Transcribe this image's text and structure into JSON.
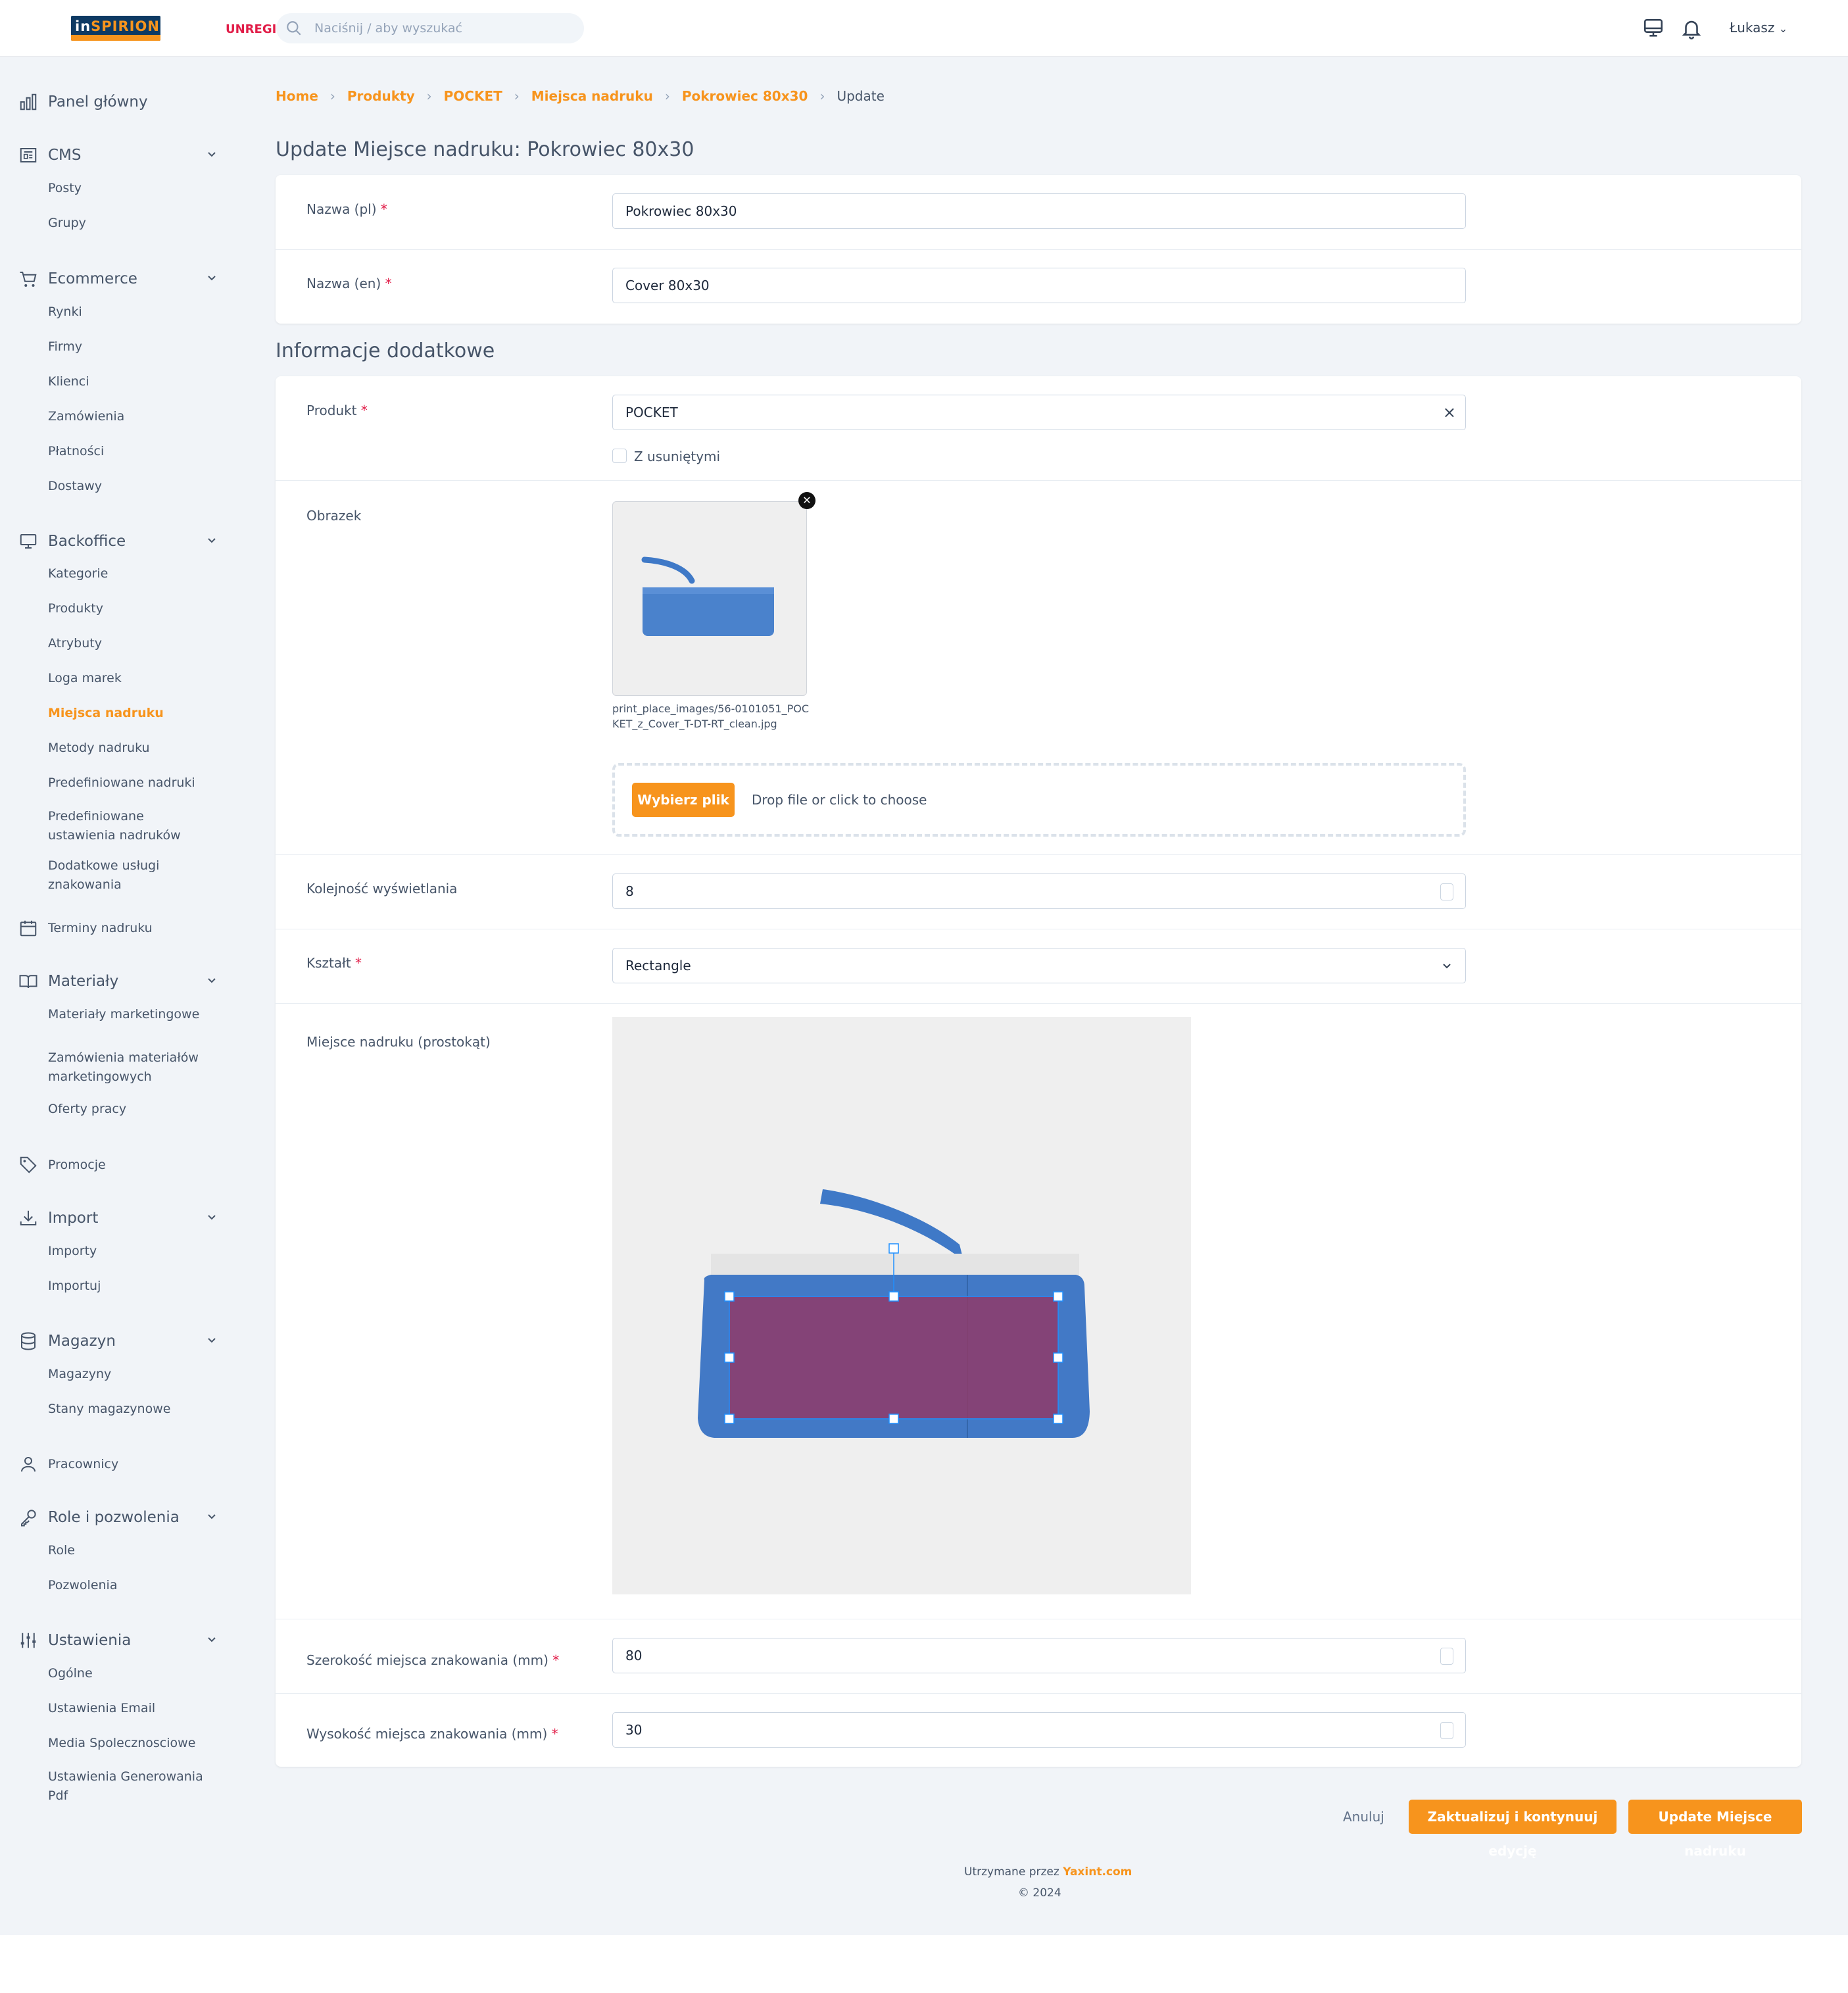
{
  "header": {
    "logo_text_a": "in",
    "logo_text_b": "SPIRION",
    "unregistered": "UNREGIS",
    "search_placeholder": "Naciśnij / aby wyszukać",
    "user_name": "Łukasz"
  },
  "sidebar": {
    "panel": "Panel główny",
    "cms": {
      "label": "CMS",
      "items": [
        "Posty",
        "Grupy"
      ]
    },
    "ecommerce": {
      "label": "Ecommerce",
      "items": [
        "Rynki",
        "Firmy",
        "Klienci",
        "Zamówienia",
        "Płatności",
        "Dostawy"
      ]
    },
    "backoffice": {
      "label": "Backoffice",
      "items": [
        "Kategorie",
        "Produkty",
        "Atrybuty",
        "Loga marek",
        "Miejsca nadruku",
        "Metody nadruku",
        "Predefiniowane nadruki",
        "Predefiniowane ustawienia nadruków",
        "Dodatkowe usługi znakowania"
      ]
    },
    "terminy": "Terminy nadruku",
    "materialy": {
      "label": "Materiały",
      "items": [
        "Materiały marketingowe",
        "Zamówienia materiałów marketingowych",
        "Oferty pracy"
      ]
    },
    "promocje": "Promocje",
    "import": {
      "label": "Import",
      "items": [
        "Importy",
        "Importuj"
      ]
    },
    "magazyn": {
      "label": "Magazyn",
      "items": [
        "Magazyny",
        "Stany magazynowe"
      ]
    },
    "pracownicy": "Pracownicy",
    "role": {
      "label": "Role i pozwolenia",
      "items": [
        "Role",
        "Pozwolenia"
      ]
    },
    "ustawienia": {
      "label": "Ustawienia",
      "items": [
        "Ogólne",
        "Ustawienia Email",
        "Media Spolecznosciowe",
        "Ustawienia Generowania Pdf"
      ]
    }
  },
  "breadcrumb": [
    "Home",
    "Produkty",
    "POCKET",
    "Miejsca nadruku",
    "Pokrowiec 80x30",
    "Update"
  ],
  "page_title": "Update Miejsce nadruku: Pokrowiec 80x30",
  "section_extra": "Informacje dodatkowe",
  "form": {
    "name_pl": {
      "label": "Nazwa (pl)",
      "value": "Pokrowiec 80x30"
    },
    "name_en": {
      "label": "Nazwa (en)",
      "value": "Cover 80x30"
    },
    "product": {
      "label": "Produkt",
      "value": "POCKET",
      "clear": "×",
      "with_deleted": "Z usuniętymi"
    },
    "image": {
      "label": "Obrazek",
      "filename": "print_place_images/56-0101051_POCKET_z_Cover_T-DT-RT_clean.jpg",
      "choose": "Wybierz plik",
      "drop": "Drop file or click to choose"
    },
    "order": {
      "label": "Kolejność wyświetlania",
      "value": "8"
    },
    "shape": {
      "label": "Kształt",
      "value": "Rectangle"
    },
    "area": {
      "label": "Miejsce nadruku (prostokąt)"
    },
    "width": {
      "label": "Szerokość miejsca znakowania (mm)",
      "value": "80"
    },
    "height": {
      "label": "Wysokość miejsca znakowania (mm)",
      "value": "30"
    }
  },
  "actions": {
    "cancel": "Anuluj",
    "update_continue": "Zaktualizuj i kontynuuj edycję",
    "update": "Update Miejsce nadruku"
  },
  "footer": {
    "maintained": "Utrzymane przez",
    "company": "Yaxint.com",
    "copyright": "© 2024"
  },
  "colors": {
    "accent": "#f7941d",
    "required": "#e11d48",
    "print_area": "#8f3a68",
    "product_blue": "#3f79c7"
  },
  "required_mark": "*"
}
